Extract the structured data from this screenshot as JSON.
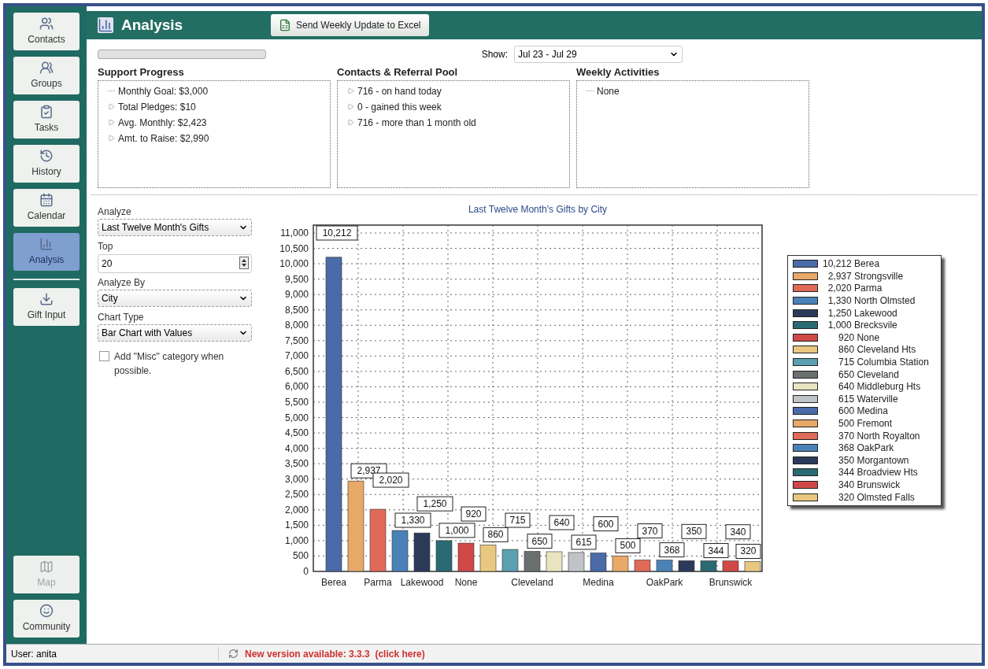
{
  "sidebar": {
    "items": [
      {
        "label": "Contacts",
        "selected": false,
        "disabled": false
      },
      {
        "label": "Groups",
        "selected": false,
        "disabled": false
      },
      {
        "label": "Tasks",
        "selected": false,
        "disabled": false
      },
      {
        "label": "History",
        "selected": false,
        "disabled": false
      },
      {
        "label": "Calendar",
        "selected": false,
        "disabled": false
      },
      {
        "label": "Analysis",
        "selected": true,
        "disabled": false
      },
      {
        "label": "Gift Input",
        "selected": false,
        "disabled": false
      }
    ],
    "bottom_items": [
      {
        "label": "Map",
        "selected": false,
        "disabled": true
      },
      {
        "label": "Community",
        "selected": false,
        "disabled": false
      }
    ]
  },
  "header": {
    "title": "Analysis",
    "button": "Send Weekly Update to Excel"
  },
  "progress": {
    "level": 0
  },
  "show": {
    "label": "Show:",
    "value": "Jul 23 - Jul 29"
  },
  "panels": [
    {
      "title": "Support Progress",
      "items": [
        {
          "text": "Monthly Goal: $3,000",
          "kind": "leaf"
        },
        {
          "text": "Total Pledges: $10",
          "kind": "branch"
        },
        {
          "text": "Avg. Monthly: $2,423",
          "kind": "branch"
        },
        {
          "text": "Amt. to Raise: $2,990",
          "kind": "branch"
        }
      ]
    },
    {
      "title": "Contacts & Referral Pool",
      "items": [
        {
          "text": "716 - on hand today",
          "kind": "branch"
        },
        {
          "text": "0 - gained this week",
          "kind": "branch"
        },
        {
          "text": "716 - more than 1 month old",
          "kind": "branch"
        }
      ]
    },
    {
      "title": "Weekly Activities",
      "items": [
        {
          "text": "None",
          "kind": "leaf"
        }
      ]
    }
  ],
  "controls": {
    "analyze": {
      "label": "Analyze",
      "value": "Last Twelve Month's Gifts"
    },
    "top": {
      "label": "Top",
      "value": "20"
    },
    "analyze_by": {
      "label": "Analyze By",
      "value": "City"
    },
    "chart_type": {
      "label": "Chart Type",
      "value": "Bar Chart with Values"
    },
    "misc": {
      "label": "Add \"Misc\" category when possible.",
      "checked": false
    }
  },
  "chart": {
    "chart_data": {
      "type": "bar",
      "title": "Last Twelve Month's Gifts by City",
      "grid": true,
      "categories": [
        "Berea",
        null,
        "Parma",
        null,
        "Lakewood",
        null,
        "None",
        null,
        null,
        "Cleveland",
        null,
        null,
        "Medina",
        null,
        null,
        "OakPark",
        null,
        null,
        "Brunswick",
        null
      ],
      "value_labels": [
        "10,212",
        "2,937",
        "2,020",
        "1,330",
        "1,250",
        "1,000",
        "920",
        "860",
        "715",
        "650",
        "640",
        "615",
        "600",
        "500",
        "370",
        "368",
        "350",
        "344",
        "340",
        "320"
      ],
      "series": [
        {
          "values": [
            10212,
            2937,
            2020,
            1330,
            1250,
            1000,
            920,
            860,
            715,
            650,
            640,
            615,
            600,
            500,
            370,
            368,
            350,
            344,
            340,
            320
          ],
          "colors": [
            "#4a6aa8",
            "#e8a868",
            "#e06a58",
            "#4a82b8",
            "#2c3a5a",
            "#2a6a72",
            "#d04848",
            "#e8c880",
            "#5aa0b0",
            "#6a7070",
            "#e8e4c0",
            "#c0c4c8",
            "#4a6aa8",
            "#e8a868",
            "#e06a58",
            "#4a82b8",
            "#2c3a5a",
            "#2a6a72",
            "#d04848",
            "#e8c880"
          ]
        }
      ],
      "ylim": [
        0,
        11000
      ],
      "yticks": [
        0,
        {
          "value": 500,
          "label": "500"
        },
        {
          "value": 1000,
          "label": "1,000"
        },
        {
          "value": 1500,
          "label": "1,500"
        },
        {
          "value": 2000,
          "label": "2,000"
        },
        {
          "value": 2500,
          "label": "2,500"
        },
        {
          "value": 3000,
          "label": "3,000"
        },
        {
          "value": 3500,
          "label": "3,500"
        },
        {
          "value": 4000,
          "label": "4,000"
        },
        {
          "value": 4500,
          "label": "4,500"
        },
        {
          "value": 5000,
          "label": "5,000"
        },
        {
          "value": 5500,
          "label": "5,500"
        },
        {
          "value": 6000,
          "label": "6,000"
        },
        {
          "value": 6500,
          "label": "6,500"
        },
        {
          "value": 7000,
          "label": "7,000"
        },
        {
          "value": 7500,
          "label": "7,500"
        },
        {
          "value": 8000,
          "label": "8,000"
        },
        {
          "value": 8500,
          "label": "8,500"
        },
        {
          "value": 9000,
          "label": "9,000"
        },
        {
          "value": 9500,
          "label": "9,500"
        },
        {
          "value": 10000,
          "label": "10,000"
        },
        {
          "value": 10500,
          "label": "10,500"
        },
        {
          "value": 11000,
          "label": "11,000"
        }
      ]
    },
    "legend": [
      {
        "text": "10,212 Berea",
        "color": "#4a6aa8"
      },
      {
        "text": "2,937 Strongsville",
        "color": "#e8a868"
      },
      {
        "text": "2,020 Parma",
        "color": "#e06a58"
      },
      {
        "text": "1,330 North Olmsted",
        "color": "#4a82b8"
      },
      {
        "text": "1,250 Lakewood",
        "color": "#2c3a5a"
      },
      {
        "text": "1,000 Brecksvile",
        "color": "#2a6a72"
      },
      {
        "text": "920 None",
        "color": "#d04848"
      },
      {
        "text": "860 Cleveland Hts",
        "color": "#e8c880"
      },
      {
        "text": "715 Columbia Station",
        "color": "#5aa0b0"
      },
      {
        "text": "650 Cleveland",
        "color": "#6a7070"
      },
      {
        "text": "640 Middleburg Hts",
        "color": "#e8e4c0"
      },
      {
        "text": "615 Waterville",
        "color": "#c0c4c8"
      },
      {
        "text": "600 Medina",
        "color": "#4a6aa8"
      },
      {
        "text": "500 Fremont",
        "color": "#e8a868"
      },
      {
        "text": "370 North Royalton",
        "color": "#e06a58"
      },
      {
        "text": "368 OakPark",
        "color": "#4a82b8"
      },
      {
        "text": "350 Morgantown",
        "color": "#2c3a5a"
      },
      {
        "text": "344 Broadview Hts",
        "color": "#2a6a72"
      },
      {
        "text": "340 Brunswick",
        "color": "#d04848"
      },
      {
        "text": "320 Olmsted Falls",
        "color": "#e8c880"
      }
    ]
  },
  "status_bar": {
    "user": "User: anita",
    "notice": "New version available: 3.3.3  (click here)"
  }
}
